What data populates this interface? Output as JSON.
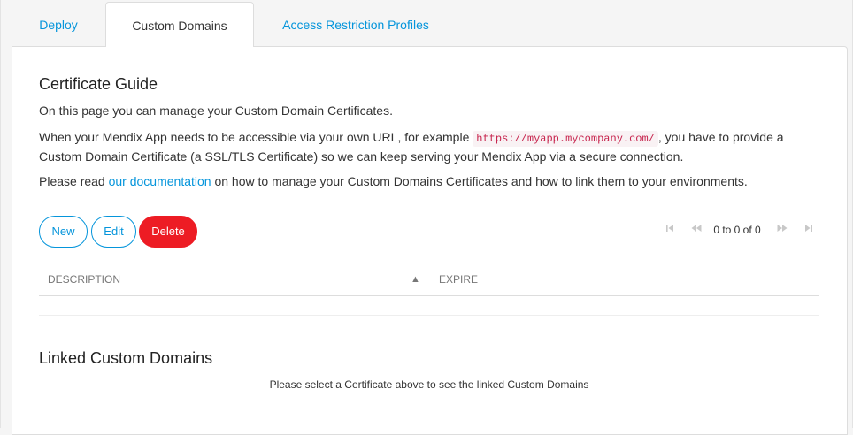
{
  "tabs": [
    {
      "label": "Deploy"
    },
    {
      "label": "Custom Domains"
    },
    {
      "label": "Access Restriction Profiles"
    }
  ],
  "certificate_guide": {
    "title": "Certificate Guide",
    "intro": "On this page you can manage your Custom Domain Certificates.",
    "para2_before": "When your Mendix App needs to be accessible via your own URL, for example ",
    "para2_code": "https://myapp.mycompany.com/",
    "para2_after": ", you have to provide a Custom Domain Certificate (a SSL/TLS Certificate) so we can keep serving your Mendix App via a secure connection.",
    "para3_before": "Please read ",
    "para3_link": "our documentation",
    "para3_after": " on how to manage your Custom Domains Certificates and how to link them to your environments."
  },
  "toolbar": {
    "new_label": "New",
    "edit_label": "Edit",
    "delete_label": "Delete"
  },
  "pager": {
    "text": "0 to 0 of 0",
    "first_icon": "first-page-icon",
    "prev_icon": "previous-page-icon",
    "next_icon": "next-page-icon",
    "last_icon": "last-page-icon"
  },
  "table": {
    "columns": [
      "DESCRIPTION",
      "EXPIRE"
    ],
    "sort_icon": "sort-ascending-icon"
  },
  "linked_domains": {
    "title": "Linked Custom Domains",
    "message": "Please select a Certificate above to see the linked Custom Domains"
  },
  "colors": {
    "accent": "#0595db",
    "danger": "#ed1c24"
  }
}
